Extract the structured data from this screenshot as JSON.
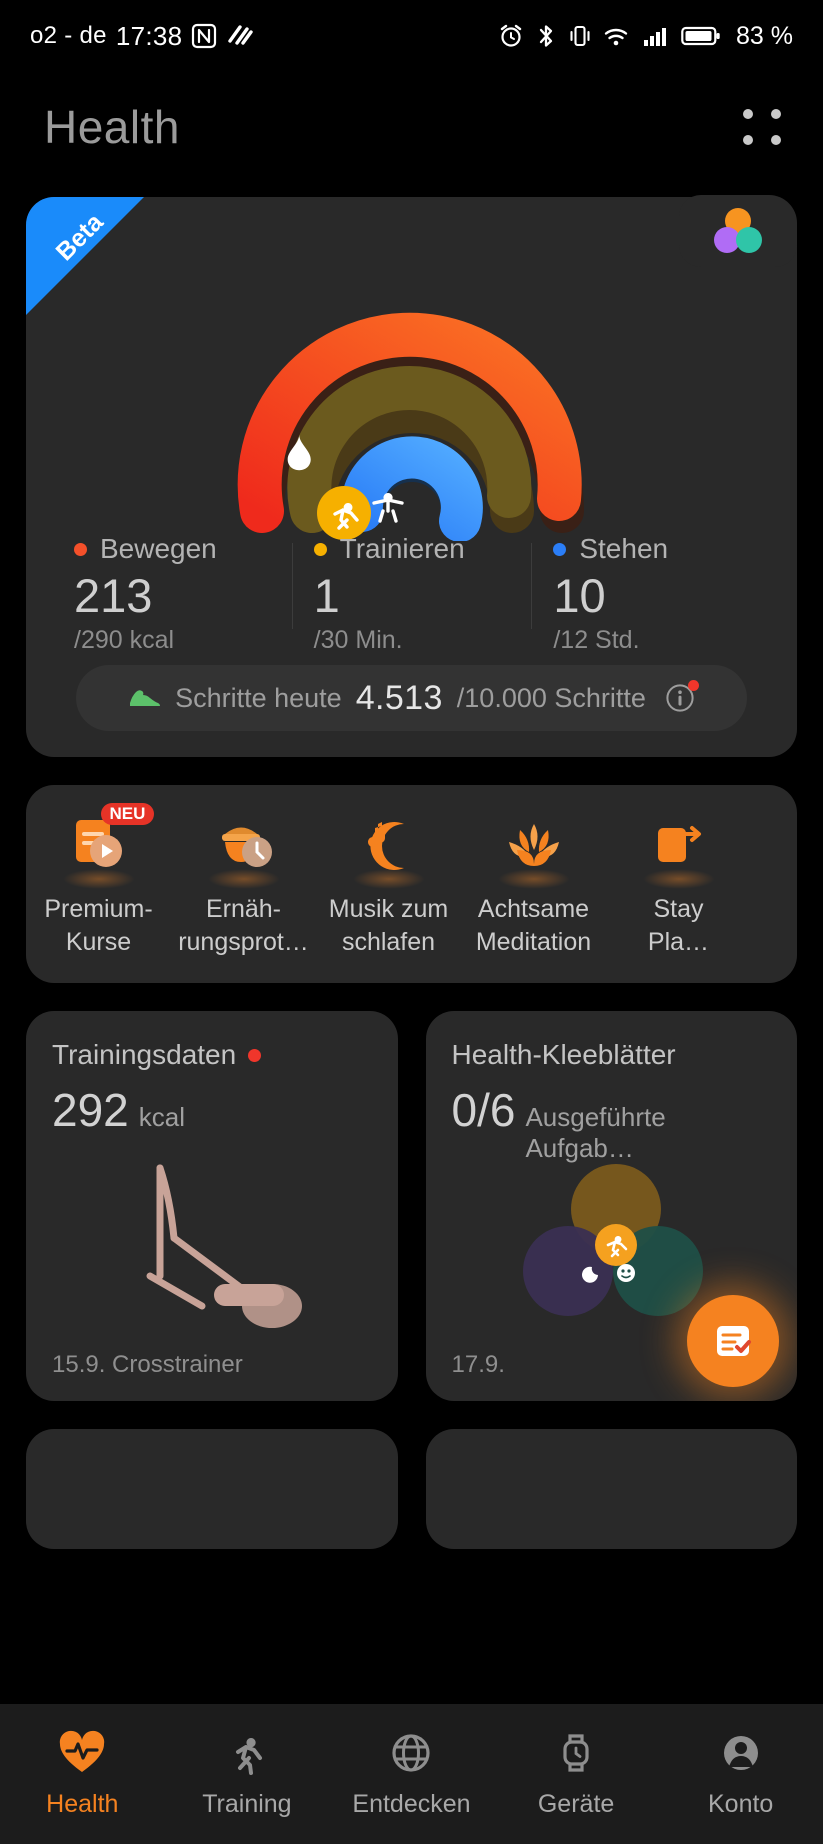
{
  "status_bar": {
    "carrier": "o2 - de",
    "time": "17:38",
    "battery_percent": "83 %",
    "icons": [
      "nfc-icon",
      "swipe-icon",
      "alarm-icon",
      "bluetooth-icon",
      "vibrate-icon",
      "wifi-icon",
      "signal-icon",
      "battery-icon"
    ]
  },
  "header": {
    "title": "Health",
    "menu_icon": "grid-dots-icon"
  },
  "rings_card": {
    "ribbon_label": "Beta",
    "trefoil_icon": "three-circles-icon",
    "ring_icons": [
      "flame-icon",
      "running-person-icon",
      "standing-person-icon"
    ],
    "stats": [
      {
        "label": "Bewegen",
        "value": "213",
        "goal": "/290 kcal",
        "color": "#f4502a",
        "icon": "flame-icon"
      },
      {
        "label": "Trainieren",
        "value": "1",
        "goal": "/30 Min.",
        "color": "#f6b000",
        "icon": "running-person-icon"
      },
      {
        "label": "Stehen",
        "value": "10",
        "goal": "/12 Std.",
        "color": "#2b7ef7",
        "icon": "standing-person-icon"
      }
    ],
    "steps": {
      "icon": "shoe-icon",
      "label": "Schritte heute",
      "value": "4.513",
      "goal": "/10.000 Schritte",
      "info_icon": "info-icon",
      "has_badge": true
    }
  },
  "shortcuts": [
    {
      "label": "Premium-\nKurse",
      "line1": "Premium-",
      "line2": "Kurse",
      "icon": "course-play-icon",
      "badge": "NEU"
    },
    {
      "label": "Ernäh-\nrungsprot…",
      "line1": "Ernäh-",
      "line2": "rungsprot…",
      "icon": "food-bowl-clock-icon",
      "badge": ""
    },
    {
      "label": "Musik zum\nschlafen",
      "line1": "Musik zum",
      "line2": "schlafen",
      "icon": "sleep-music-icon",
      "badge": ""
    },
    {
      "label": "Achtsame\nMeditation",
      "line1": "Achtsame",
      "line2": "Meditation",
      "icon": "lotus-icon",
      "badge": ""
    },
    {
      "label": "Stay\nPla…",
      "line1": "Stay",
      "line2": "Pla…",
      "icon": "stay-plan-icon",
      "badge": ""
    }
  ],
  "cards": [
    {
      "title": "Trainingsdaten",
      "has_reddot": true,
      "value": "292",
      "unit": "kcal",
      "footer": "15.9.  Crosstrainer",
      "art_icon": "crosstrainer-icon"
    },
    {
      "title": "Health-Kleeblätter",
      "has_reddot": false,
      "value": "0/6",
      "unit": "Ausgeführte Aufgab…",
      "footer": "17.9.",
      "art_icon": "clover-circles-icon",
      "fab_icon": "checklist-icon"
    }
  ],
  "bottom_nav": [
    {
      "label": "Health",
      "icon": "heart-pulse-icon",
      "active": true
    },
    {
      "label": "Training",
      "icon": "runner-icon",
      "active": false
    },
    {
      "label": "Entdecken",
      "icon": "globe-icon",
      "active": false
    },
    {
      "label": "Geräte",
      "icon": "watch-icon",
      "active": false
    },
    {
      "label": "Konto",
      "icon": "person-icon",
      "active": false
    }
  ],
  "colors": {
    "accent": "#f58220",
    "move_ring": "#f4502a",
    "exercise_ring": "#f6b000",
    "stand_ring": "#2b7ef7",
    "card_bg": "#292929",
    "badge_red": "#f0362b",
    "beta_blue": "#1a8bfa"
  }
}
